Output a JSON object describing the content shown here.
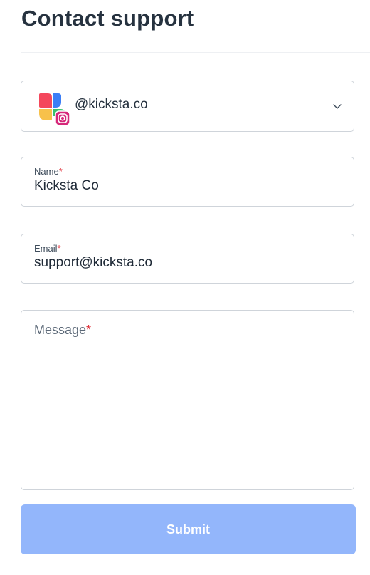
{
  "page": {
    "title": "Contact support"
  },
  "account_select": {
    "handle": "@kicksta.co",
    "platform_icon": "instagram-icon",
    "brand_colors": [
      "#f4475c",
      "#f7c14b",
      "#3b7ef6",
      "#39c26d"
    ]
  },
  "name_field": {
    "label": "Name",
    "required_mark": "*",
    "value": "Kicksta Co"
  },
  "email_field": {
    "label": "Email",
    "required_mark": "*",
    "value": "support@kicksta.co"
  },
  "message_field": {
    "placeholder": "Message",
    "required_mark": "*",
    "value": ""
  },
  "submit": {
    "label": "Submit",
    "color": "#93b6fb"
  }
}
